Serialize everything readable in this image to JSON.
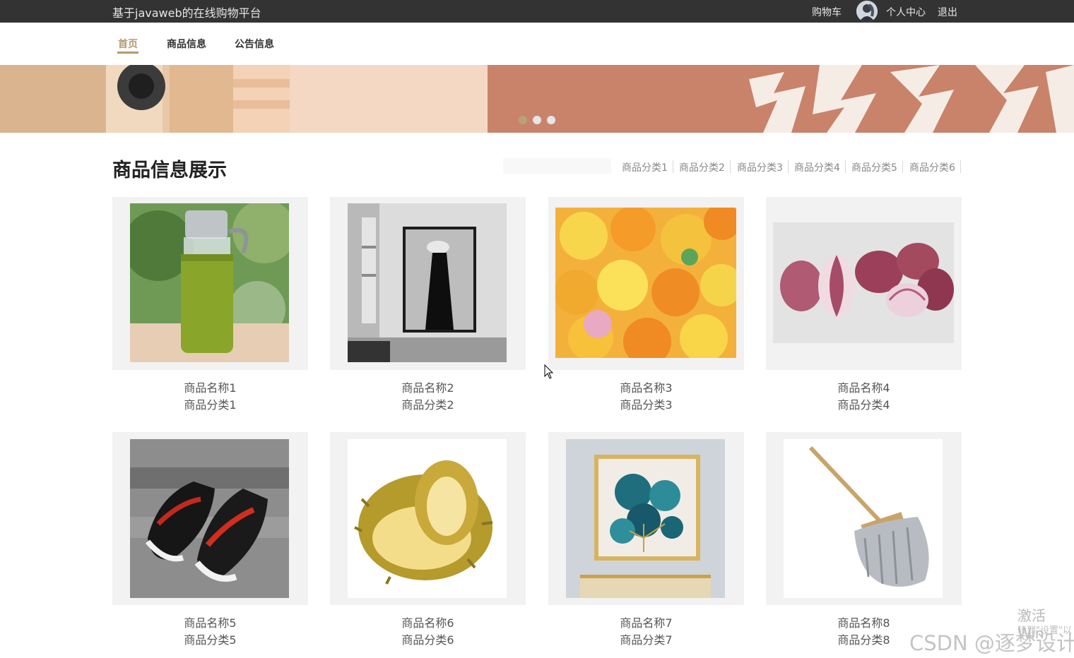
{
  "topbar": {
    "site_title": "基于javaweb的在线购物平台",
    "cart": "购物车",
    "profile": "个人中心",
    "logout": "退出"
  },
  "nav": {
    "items": [
      {
        "label": "首页",
        "active": true
      },
      {
        "label": "商品信息",
        "active": false
      },
      {
        "label": "公告信息",
        "active": false
      }
    ]
  },
  "banner": {
    "slide_count": 3,
    "active_slide": 1
  },
  "section": {
    "title": "商品信息展示",
    "search_placeholder": "",
    "categories": [
      "商品分类1",
      "商品分类2",
      "商品分类3",
      "商品分类4",
      "商品分类5",
      "商品分类6"
    ]
  },
  "products": [
    {
      "name": "商品名称1",
      "category": "商品分类1",
      "image": "green-water-bottle"
    },
    {
      "name": "商品名称2",
      "category": "商品分类2",
      "image": "framed-wall-art"
    },
    {
      "name": "商品名称3",
      "category": "商品分类3",
      "image": "jelly-cups"
    },
    {
      "name": "商品名称4",
      "category": "商品分类4",
      "image": "red-onions"
    },
    {
      "name": "商品名称5",
      "category": "商品分类5",
      "image": "sneakers"
    },
    {
      "name": "商品名称6",
      "category": "商品分类6",
      "image": "durian"
    },
    {
      "name": "商品名称7",
      "category": "商品分类7",
      "image": "ginkgo-painting"
    },
    {
      "name": "商品名称8",
      "category": "商品分类8",
      "image": "mop"
    }
  ],
  "watermark": {
    "activate_line1": "激活 Win",
    "activate_line2": "转到\"设置\"以",
    "csdn": "CSDN @逐梦设计"
  },
  "colors": {
    "topbar": "#333333",
    "accent": "#b49a6f",
    "card_frame": "#f2f2f2"
  }
}
